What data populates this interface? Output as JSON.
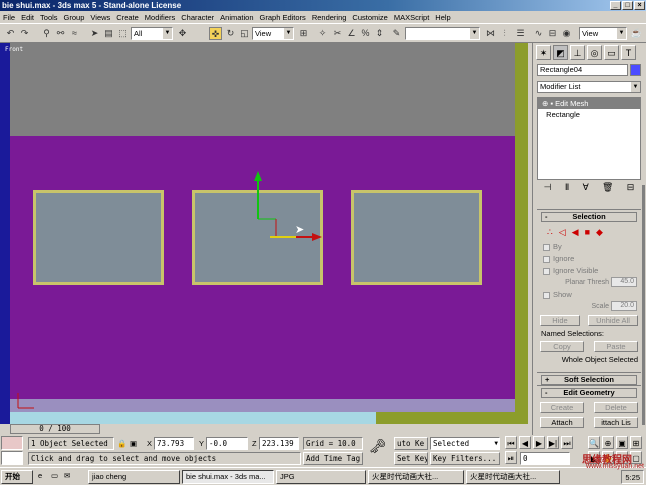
{
  "window": {
    "title": "bie shui.max - 3ds max 5 - Stand-alone License"
  },
  "menu": [
    "File",
    "Edit",
    "Tools",
    "Group",
    "Views",
    "Create",
    "Modifiers",
    "Character",
    "Animation",
    "Graph Editors",
    "Rendering",
    "Customize",
    "MAXScript",
    "Help"
  ],
  "toolbar": {
    "selection_filter": "All",
    "ref_coord": "View",
    "ref_coord2": "View",
    "named_sel": ""
  },
  "viewport": {
    "label": "Front"
  },
  "command_panel": {
    "object_name": "Rectangle04",
    "object_color": "#4b4bff",
    "modifier_list": "Modifier List",
    "stack": [
      "Edit Mesh",
      "Rectangle"
    ],
    "selection": {
      "title": "Selection",
      "by": "By",
      "ignore": "Ignore",
      "ignore_visible": "Ignore Visible",
      "planar_thresh_label": "Planar Thresh",
      "planar_thresh_value": "45.0",
      "show": "Show",
      "scale_label": "Scale",
      "scale_value": "20.0",
      "hide": "Hide",
      "unhide_all": "Unhide All",
      "named_selections": "Named Selections:",
      "copy": "Copy",
      "paste": "Paste",
      "whole_object": "Whole Object Selected"
    },
    "soft_selection": "Soft Selection",
    "edit_geometry": "Edit Geometry",
    "create": "Create",
    "delete": "Delete",
    "attach": "Attach",
    "attach_list": "ittach Lis"
  },
  "timeslider": {
    "text": "0 / 100"
  },
  "status": {
    "selected": "1 Object Selected",
    "x_label": "X",
    "x": "73.793",
    "y_label": "Y",
    "y": "-0.0",
    "z_label": "Z",
    "z": "223.139",
    "grid": "Grid = 10.0",
    "prompt": "Click and drag to select and move objects",
    "add_time_tag": "Add Time Tag",
    "auto_key": "uto Ke",
    "set_key": "Set Key",
    "key_filter_value": "Selected",
    "key_filters": "Key Filters...",
    "frame": "0"
  },
  "taskbar": {
    "start": "开始",
    "items": [
      "jiao cheng",
      "bie shui.max - 3ds ma...",
      "JPG",
      "火星时代动画大社...",
      "火星时代动画大社..."
    ],
    "time": "5:25"
  },
  "watermark": {
    "site": "思缘教程网",
    "url": "www.missyuan.net"
  }
}
